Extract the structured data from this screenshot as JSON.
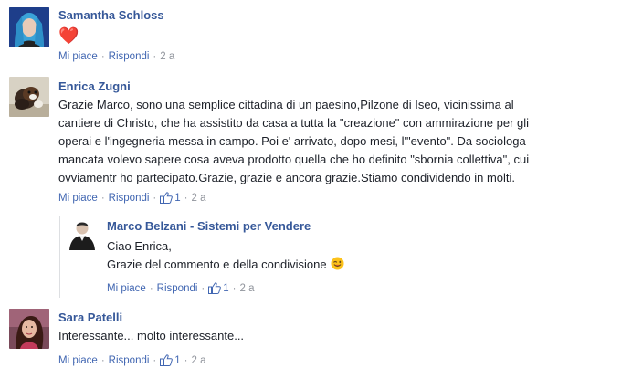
{
  "comments": [
    {
      "author": "Samantha Schloss",
      "text_lines": [],
      "reaction_emoji": "❤️",
      "actions": {
        "like": "Mi piace",
        "reply": "Rispondi",
        "time": "2 a"
      }
    },
    {
      "author": "Enrica Zugni",
      "text_lines": [
        "Grazie Marco, sono una semplice cittadina di un paesino,Pilzone di Iseo, vicinissima al",
        "cantiere di Christo, che ha assistito da casa a tutta la \"creazione\" con ammirazione per gli",
        "operai e l'ingegneria messa in campo. Poi e' arrivato, dopo mesi, l'\"evento\". Da sociologa",
        "mancata volevo sapere cosa aveva prodotto quella che ho definito \"sbornia collettiva\", cui",
        "ovviamentr ho partecipato.Grazie, grazie e ancora grazie.Stiamo condividendo in molti."
      ],
      "actions": {
        "like": "Mi piace",
        "reply": "Rispondi",
        "likes": "1",
        "time": "2 a"
      }
    },
    {
      "author": "Marco Belzani - Sistemi per Vendere",
      "text_lines": [
        "Ciao Enrica,",
        "Grazie del commento e della condivisione"
      ],
      "emoji": "wink-emoji-icon",
      "actions": {
        "like": "Mi piace",
        "reply": "Rispondi",
        "likes": "1",
        "time": "2 a"
      }
    },
    {
      "author": "Sara Patelli",
      "text_lines": [
        "Interessante... molto interessante..."
      ],
      "actions": {
        "like": "Mi piace",
        "reply": "Rispondi",
        "likes": "1",
        "time": "2 a"
      }
    }
  ],
  "separator": "·",
  "colors": {
    "author": "#365899",
    "link": "#4267b2",
    "meta": "#90949c",
    "text": "#1d2129",
    "divider": "#e9ebee"
  }
}
